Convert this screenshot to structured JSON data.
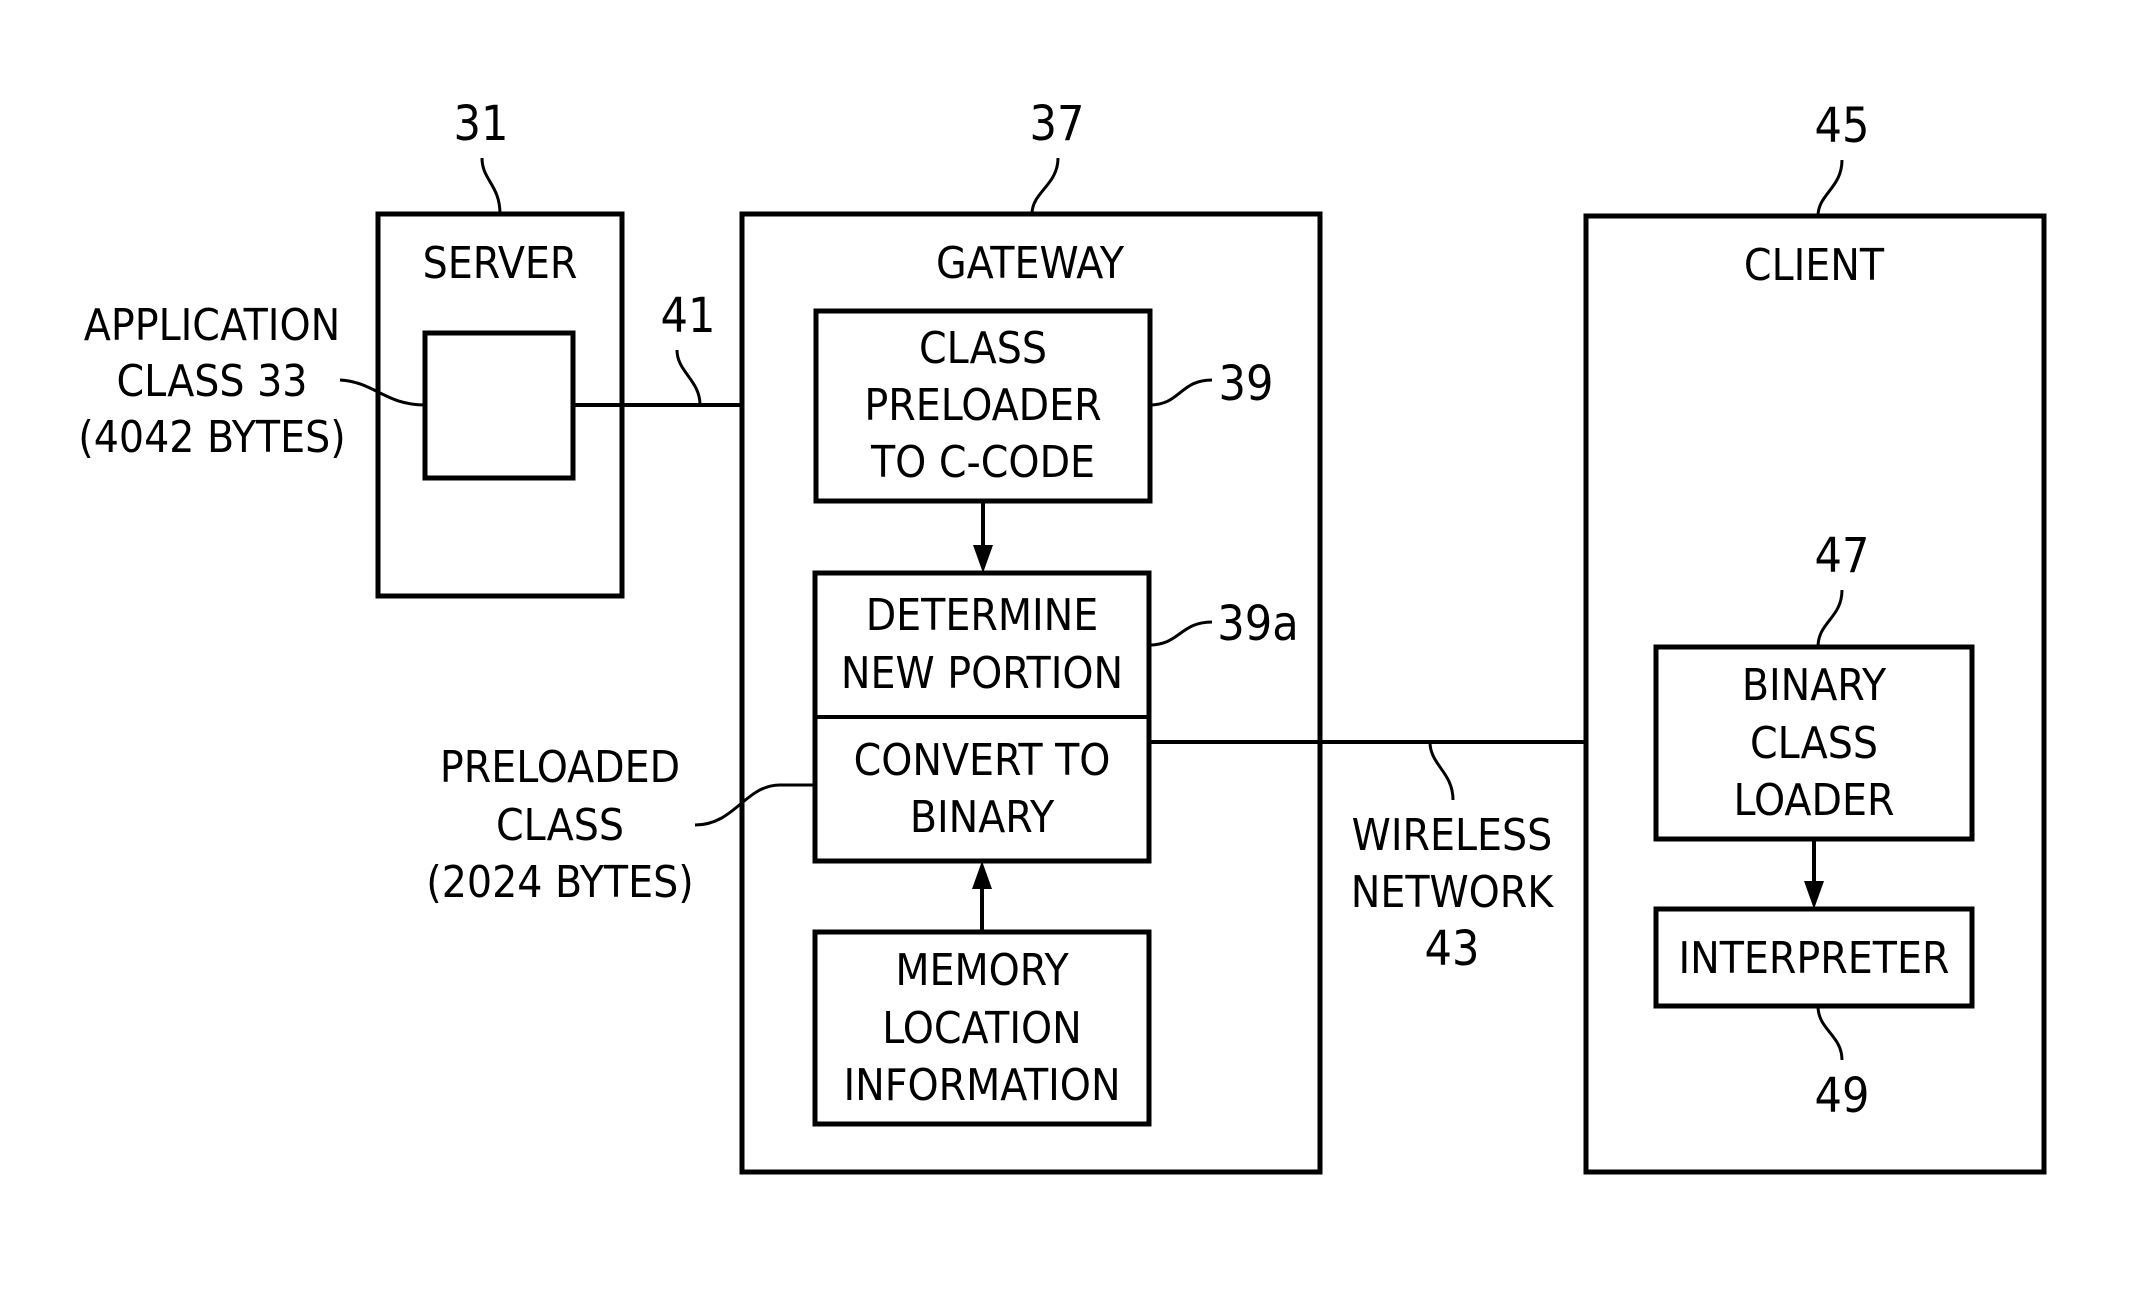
{
  "figure": {
    "server": {
      "ref": "31",
      "title": "SERVER",
      "app_class_label": [
        "APPLICATION",
        "CLASS 33",
        "(4042 BYTES)"
      ]
    },
    "connection_41": {
      "ref": "41"
    },
    "gateway": {
      "ref": "37",
      "title": "GATEWAY",
      "class_preloader": {
        "ref": "39",
        "lines": [
          "CLASS",
          "PRELOADER",
          "TO C-CODE"
        ]
      },
      "determine": {
        "ref": "39a",
        "lines": [
          "DETERMINE",
          "NEW PORTION"
        ]
      },
      "convert": {
        "lines": [
          "CONVERT TO",
          "BINARY"
        ]
      },
      "memory": {
        "lines": [
          "MEMORY",
          "LOCATION",
          "INFORMATION"
        ]
      },
      "preloaded_class_label": [
        "PRELOADED",
        "CLASS",
        "(2024 BYTES)"
      ]
    },
    "network": {
      "lines": [
        "WIRELESS",
        "NETWORK",
        "43"
      ]
    },
    "client": {
      "ref": "45",
      "title": "CLIENT",
      "binary_loader": {
        "ref": "47",
        "lines": [
          "BINARY",
          "CLASS",
          "LOADER"
        ]
      },
      "interpreter": {
        "ref": "49",
        "lines": [
          "INTERPRETER"
        ]
      }
    }
  }
}
